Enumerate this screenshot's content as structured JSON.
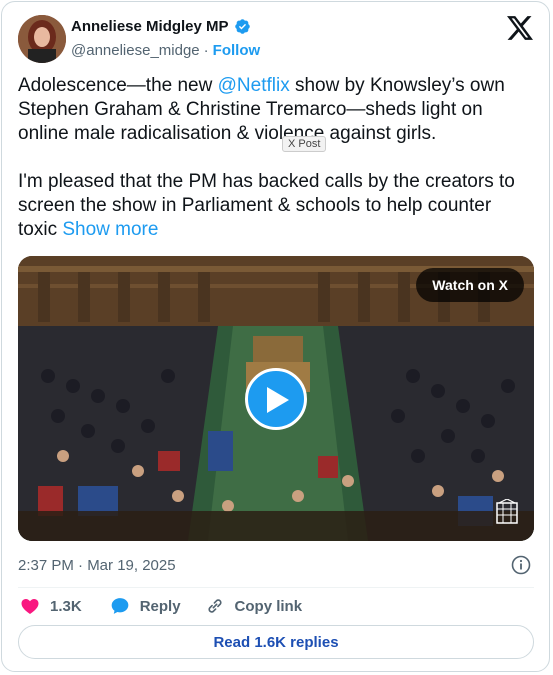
{
  "author": {
    "name": "Anneliese Midgley MP",
    "handle": "@anneliese_midge",
    "separator": "·",
    "follow_label": "Follow"
  },
  "tweet": {
    "p1_pre": "Adolescence—the new ",
    "p1_mention": "@Netflix",
    "p1_post": " show by Knowsley’s own Stephen Graham & Christine Tremarco—sheds light on online male radicalisation & violence against girls.",
    "p2": "I'm pleased that the PM has backed calls by the creators to screen the show in Parliament & schools to help counter toxic ",
    "show_more": "Show more"
  },
  "tooltip": "X Post",
  "media": {
    "watch_label": "Watch on X"
  },
  "timestamp": "2:37 PM · Mar 19, 2025",
  "actions": {
    "likes": "1.3K",
    "reply": "Reply",
    "copy_link": "Copy link"
  },
  "read_replies": "Read 1.6K replies",
  "colors": {
    "accent": "#1d9bf0",
    "like": "#f91880",
    "muted": "#536471"
  }
}
